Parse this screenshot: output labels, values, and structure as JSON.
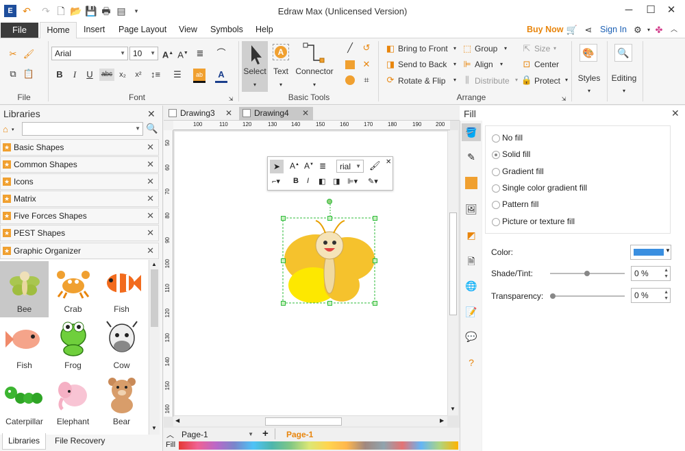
{
  "app": {
    "title": "Edraw Max (Unlicensed Version)"
  },
  "colors": {
    "accent_dark": "#3c3c3c",
    "buy_now": "#e8850c",
    "sign_in": "#1a5fb4",
    "fill_color": "#3a8fe0",
    "selection": "#2dbb3a"
  },
  "menu": {
    "file": "File",
    "tabs": [
      "Home",
      "Insert",
      "Page Layout",
      "View",
      "Symbols",
      "Help"
    ],
    "buy_now": "Buy Now",
    "sign_in": "Sign In"
  },
  "ribbon": {
    "file_group": "File",
    "font_group": "Font",
    "font_name": "Arial",
    "font_size": "10",
    "basic_tools_group": "Basic Tools",
    "select_label": "Select",
    "text_label": "Text",
    "connector_label": "Connector",
    "arrange_group": "Arrange",
    "bring_to_front": "Bring to Front",
    "send_to_back": "Send to Back",
    "rotate_flip": "Rotate & Flip",
    "group": "Group",
    "align": "Align",
    "distribute": "Distribute",
    "size": "Size",
    "center": "Center",
    "protect": "Protect",
    "styles": "Styles",
    "editing": "Editing"
  },
  "libraries": {
    "title": "Libraries",
    "items": [
      "Basic Shapes",
      "Common Shapes",
      "Icons",
      "Matrix",
      "Five Forces Shapes",
      "PEST Shapes",
      "Graphic Organizer"
    ],
    "shapes": [
      "Bee",
      "Crab",
      "Fish",
      "Fish",
      "Frog",
      "Cow",
      "Caterpillar",
      "Elephant",
      "Bear"
    ],
    "bottom_tabs": [
      "Libraries",
      "File Recovery"
    ]
  },
  "documents": {
    "tabs": [
      "Drawing3",
      "Drawing4"
    ]
  },
  "ruler": {
    "h": [
      "100",
      "110",
      "120",
      "130",
      "140",
      "150",
      "160",
      "170",
      "180",
      "190",
      "200"
    ],
    "v": [
      "50",
      "60",
      "70",
      "80",
      "90",
      "100",
      "110",
      "120",
      "130",
      "140",
      "150",
      "160"
    ]
  },
  "mini_toolbar": {
    "font": "rial"
  },
  "status": {
    "page_select": "Page-1",
    "page_tab": "Page-1",
    "fill_label": "Fill"
  },
  "fill_panel": {
    "title": "Fill",
    "options": [
      "No fill",
      "Solid fill",
      "Gradient fill",
      "Single color gradient fill",
      "Pattern fill",
      "Picture or texture fill"
    ],
    "selected": "Solid fill",
    "color_label": "Color:",
    "shade_label": "Shade/Tint:",
    "shade_value": "0 %",
    "transparency_label": "Transparency:",
    "transparency_value": "0 %"
  }
}
